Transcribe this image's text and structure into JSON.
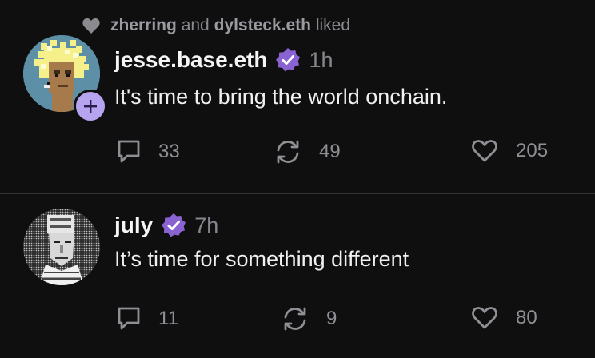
{
  "liked_bar": {
    "user_1": "zherring",
    "conjunction": "and",
    "user_2": "dylsteck.eth",
    "suffix": "liked"
  },
  "posts": [
    {
      "username": "jesse.base.eth",
      "time": "1h",
      "text": "It's time to bring the world onchain.",
      "replies": "33",
      "recasts": "49",
      "likes": "205"
    },
    {
      "username": "july",
      "time": "7h",
      "text": "It’s time for something different",
      "replies": "11",
      "recasts": "9",
      "likes": "80"
    }
  ],
  "colors": {
    "background": "#0f0f10",
    "verified": "#8a63d2",
    "follow_badge": "#b7a4f1",
    "muted": "#8f8f95"
  },
  "icons": [
    "heart-icon",
    "verified-icon",
    "plus-icon",
    "comment-icon",
    "recast-icon",
    "like-heart-icon"
  ]
}
